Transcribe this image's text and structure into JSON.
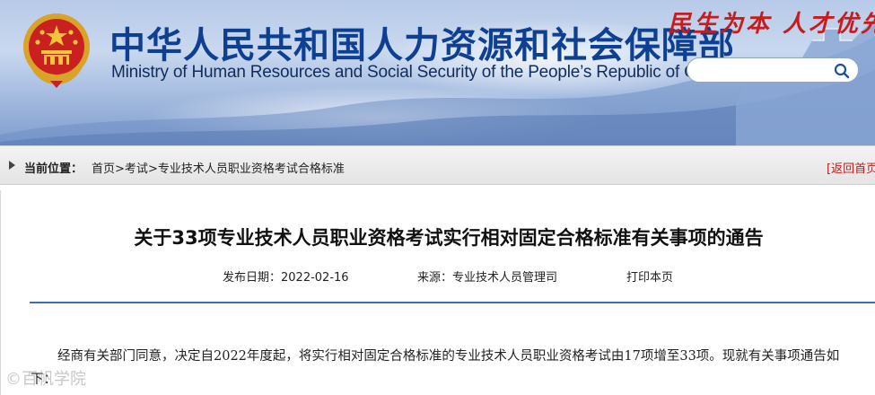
{
  "header": {
    "title_cn": "中华人民共和国人力资源和社会保障部",
    "title_en": "Ministry of Human Resources and Social Security of the People’s Republic of China",
    "slogan": "民生为本 人才优先",
    "search": {
      "value": "",
      "placeholder": ""
    }
  },
  "breadcrumb": {
    "label": "当前位置：",
    "items": [
      "首页",
      "考试",
      "专业技术人员职业资格考试合格标准"
    ],
    "separator": ">",
    "back_link": "[返回首页"
  },
  "article": {
    "title": "关于33项专业技术人员职业资格考试实行相对固定合格标准有关事项的通告",
    "date_label": "发布日期：",
    "date": "2022-02-16",
    "source_label": "来源：",
    "source": "专业技术人员管理司",
    "print_label": "打印本页",
    "paragraph": "经商有关部门同意，决定自2022年度起，将实行相对固定合格标准的专业技术人员职业资格考试由17项增至33项。现就有关事项通告如下："
  },
  "watermark": "©百帆学院",
  "colors": {
    "title_blue": "#0d3f92",
    "slogan_red": "#c81b1b",
    "divider_blue": "#3b6fb5",
    "back_link_red": "#c11a1a"
  },
  "icons": {
    "search": "search-icon",
    "emblem": "national-emblem-icon"
  }
}
